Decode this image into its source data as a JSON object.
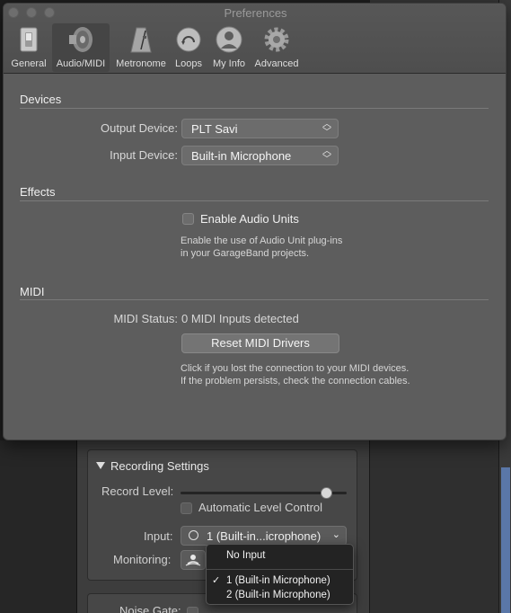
{
  "window": {
    "title": "Preferences"
  },
  "toolbar": {
    "items": [
      {
        "label": "General",
        "icon": "general-switch-icon"
      },
      {
        "label": "Audio/MIDI",
        "icon": "speaker-icon",
        "selected": true
      },
      {
        "label": "Metronome",
        "icon": "metronome-icon"
      },
      {
        "label": "Loops",
        "icon": "loops-icon"
      },
      {
        "label": "My Info",
        "icon": "user-icon"
      },
      {
        "label": "Advanced",
        "icon": "gear-icon"
      }
    ]
  },
  "devices": {
    "heading": "Devices",
    "output_label": "Output Device:",
    "output_value": "PLT Savi",
    "input_label": "Input Device:",
    "input_value": "Built-in Microphone"
  },
  "effects": {
    "heading": "Effects",
    "checkbox_label": "Enable Audio Units",
    "checked": false,
    "help_line1": "Enable the use of Audio Unit plug-ins",
    "help_line2": "in your GarageBand projects."
  },
  "midi": {
    "heading": "MIDI",
    "status_label": "MIDI Status:",
    "status_value": "0 MIDI Inputs detected",
    "reset_button": "Reset MIDI Drivers",
    "help_line1": "Click if you lost the connection to your MIDI devices.",
    "help_line2": "If the problem persists, check the connection cables."
  },
  "recording": {
    "title": "Recording Settings",
    "record_level_label": "Record Level:",
    "record_level": 0.88,
    "auto_level_label": "Automatic Level Control",
    "input_label": "Input:",
    "input_value": "1  (Built-in...icrophone)",
    "monitoring_label": "Monitoring:",
    "noise_gate_label": "Noise Gate:"
  },
  "input_menu": {
    "items": [
      {
        "label": "No Input",
        "checked": false
      },
      {
        "label": "1  (Built-in Microphone)",
        "checked": true
      },
      {
        "label": "2  (Built-in Microphone)",
        "checked": false
      }
    ],
    "check_glyph": "✓"
  },
  "colors": {
    "window_bg": "#5d5d5d",
    "menu_bg": "#232323",
    "accent_blue": "#5a77a8"
  }
}
